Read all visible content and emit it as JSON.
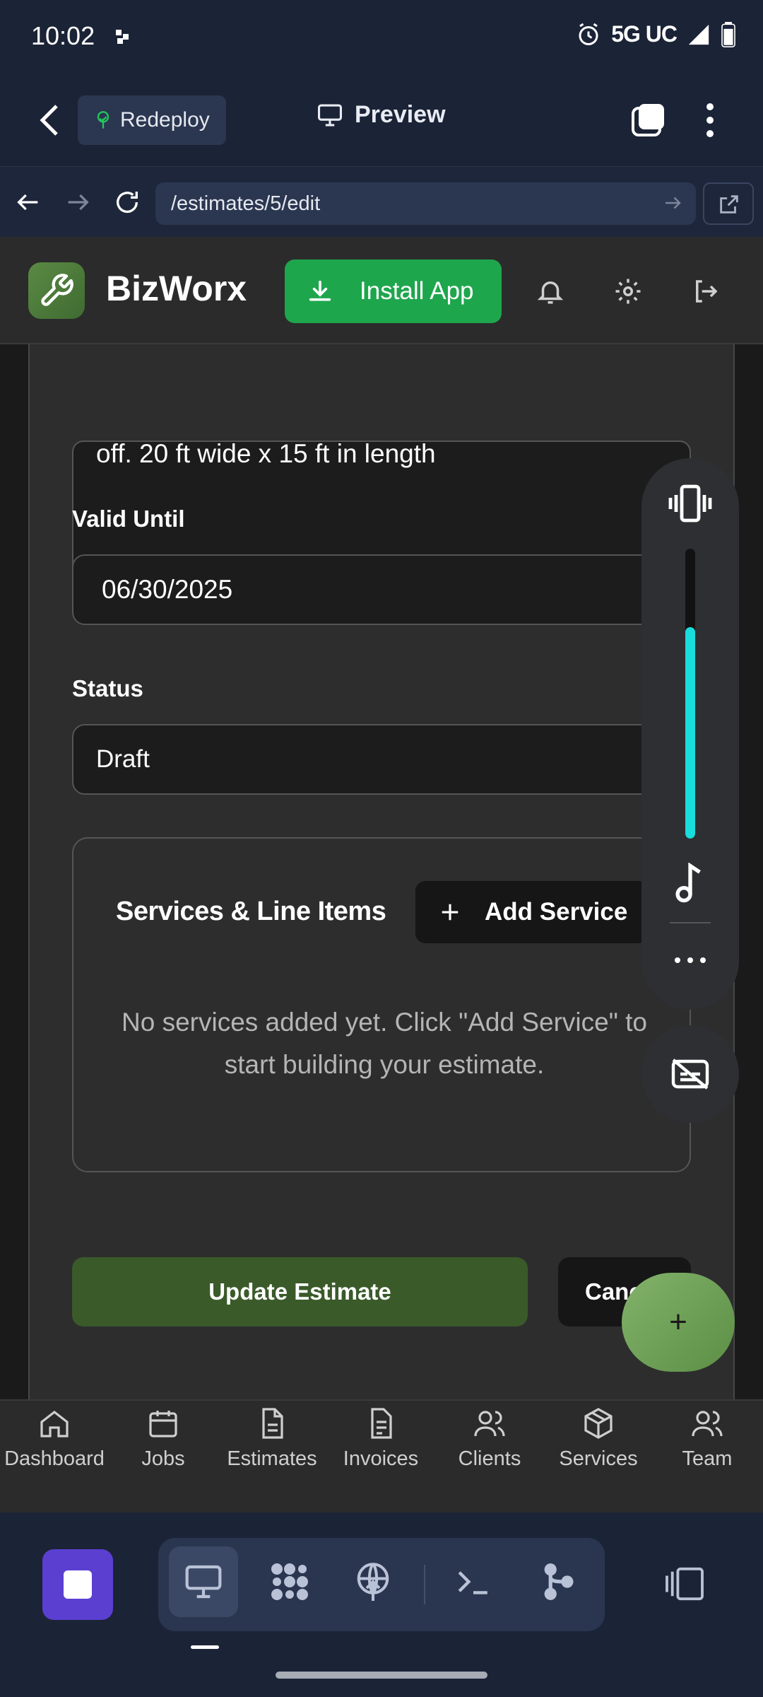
{
  "status_bar": {
    "time": "10:02",
    "network": "5G UC"
  },
  "preview_header": {
    "redeploy_label": "Redeploy",
    "preview_label": "Preview"
  },
  "browser": {
    "url": "/estimates/5/edit"
  },
  "app_header": {
    "brand": "BizWorx",
    "install_label": "Install App"
  },
  "form": {
    "description_text": "off. 20 ft wide x 15 ft in length",
    "valid_until_label": "Valid Until",
    "valid_until_value": "06/30/2025",
    "status_label": "Status",
    "status_value": "Draft"
  },
  "services": {
    "title": "Services & Line Items",
    "add_label": "Add Service",
    "empty_text": "No services added yet. Click \"Add Service\" to start building your estimate."
  },
  "actions": {
    "update_label": "Update Estimate",
    "cancel_label": "Cancel",
    "fab_label": "+"
  },
  "bottom_nav": [
    {
      "label": "Dashboard",
      "icon": "home-icon"
    },
    {
      "label": "Jobs",
      "icon": "calendar-icon"
    },
    {
      "label": "Estimates",
      "icon": "document-icon"
    },
    {
      "label": "Invoices",
      "icon": "receipt-icon"
    },
    {
      "label": "Clients",
      "icon": "users-icon"
    },
    {
      "label": "Services",
      "icon": "box-icon"
    },
    {
      "label": "Team",
      "icon": "team-icon"
    }
  ],
  "volume": {
    "level": 0.73
  },
  "colors": {
    "accent_green": "#1ea64d",
    "brand_green": "#5b8a44",
    "volume_cyan": "#19dcdc",
    "dock_stop": "#5b3fd1"
  }
}
